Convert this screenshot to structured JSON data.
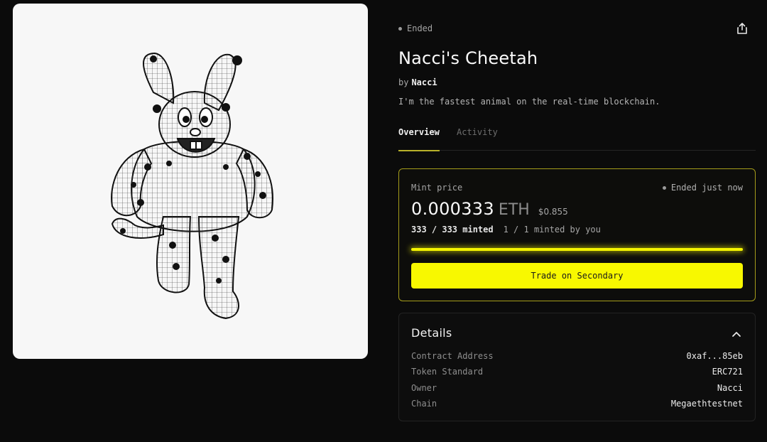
{
  "artwork": {
    "alt": "Nacci's Cheetah"
  },
  "header": {
    "status": "Ended",
    "share_icon": "share-icon"
  },
  "collection": {
    "title": "Nacci's Cheetah",
    "by_label": "by",
    "creator": "Nacci",
    "description": "I'm the fastest animal on the real-time blockchain."
  },
  "tabs": [
    {
      "label": "Overview",
      "active": true
    },
    {
      "label": "Activity",
      "active": false
    }
  ],
  "mint": {
    "label": "Mint price",
    "status": "Ended just now",
    "price": "0.000333",
    "currency": "ETH",
    "usd": "$0.855",
    "minted_total": "333 / 333 minted",
    "minted_by_you": "1 / 1 minted by you",
    "progress": 1.0,
    "button_label": "Trade on Secondary",
    "accent_color": "#f8f800"
  },
  "details": {
    "title": "Details",
    "toggle_icon": "chevron-up-icon",
    "rows": [
      {
        "key": "Contract Address",
        "value": "0xaf...85eb"
      },
      {
        "key": "Token Standard",
        "value": "ERC721"
      },
      {
        "key": "Owner",
        "value": "Nacci"
      },
      {
        "key": "Chain",
        "value": "Megaethtestnet"
      }
    ]
  }
}
